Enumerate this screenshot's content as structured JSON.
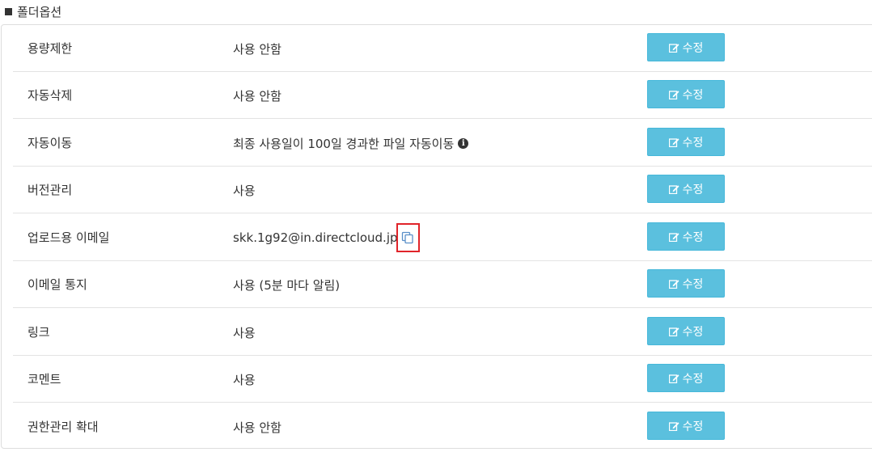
{
  "section": {
    "title": "폴더옵션",
    "icon": "square-icon"
  },
  "rows": [
    {
      "label": "용량제한",
      "value": "사용 안함",
      "button": "수정"
    },
    {
      "label": "자동삭제",
      "value": "사용 안함",
      "button": "수정"
    },
    {
      "label": "자동이동",
      "value": "최종 사용일이 100일 경과한 파일 자동이동",
      "value_icon": "info-icon",
      "button": "수정"
    },
    {
      "label": "버전관리",
      "value": "사용",
      "button": "수정"
    },
    {
      "label": "업로드용 이메일",
      "value": "skk.1g92@in.directcloud.jp",
      "value_icon": "copy-icon",
      "button": "수정"
    },
    {
      "label": "이메일 통지",
      "value": "사용 (5분 마다 알림)",
      "button": "수정"
    },
    {
      "label": "링크",
      "value": "사용",
      "button": "수정"
    },
    {
      "label": "코멘트",
      "value": "사용",
      "button": "수정"
    },
    {
      "label": "권한관리 확대",
      "value": "사용 안함",
      "button": "수정"
    }
  ],
  "colors": {
    "button_bg": "#5bc0de",
    "highlight_box": "#e0242a"
  }
}
